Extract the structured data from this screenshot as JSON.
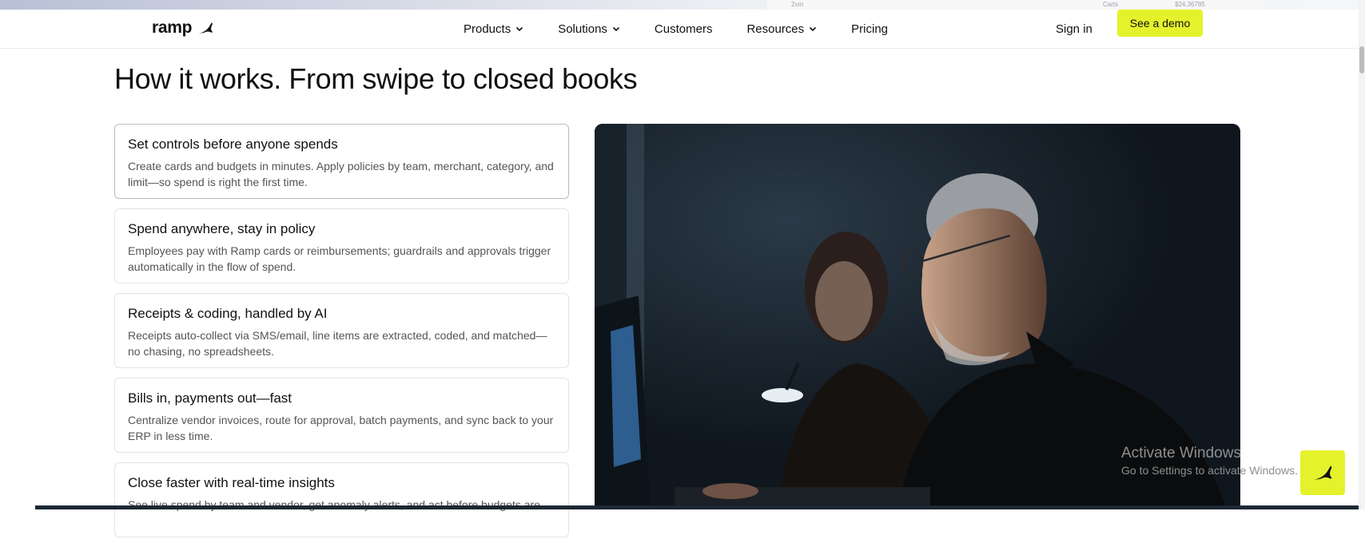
{
  "nav": {
    "logo_text": "ramp",
    "items": [
      {
        "label": "Products",
        "has_dropdown": true
      },
      {
        "label": "Solutions",
        "has_dropdown": true
      },
      {
        "label": "Customers",
        "has_dropdown": false
      },
      {
        "label": "Resources",
        "has_dropdown": true
      },
      {
        "label": "Pricing",
        "has_dropdown": false
      }
    ],
    "sign_in": "Sign in",
    "cta": "See a demo"
  },
  "top_strip": {
    "label_a": "2xm",
    "label_b": "Carts",
    "label_c": "$24,36785"
  },
  "section": {
    "title": "How it works. From swipe to closed books",
    "cards": [
      {
        "title": "Set controls before anyone spends",
        "desc": "Create cards and budgets in minutes. Apply policies by team, merchant, category, and limit—so spend is right the first time.",
        "active": true
      },
      {
        "title": "Spend anywhere, stay in policy",
        "desc": "Employees pay with Ramp cards or reimbursements; guardrails and approvals trigger automatically in the flow of spend.",
        "active": false
      },
      {
        "title": "Receipts & coding, handled by AI",
        "desc": "Receipts auto-collect via SMS/email, line items are extracted, coded, and matched—no chasing, no spreadsheets.",
        "active": false
      },
      {
        "title": "Bills in, payments out—fast",
        "desc": "Centralize vendor invoices, route for approval, batch payments, and sync back to your ERP in less time.",
        "active": false
      },
      {
        "title": "Close faster with real-time insights",
        "desc": "See live spend by team and vendor, get anomaly alerts, and act before budgets are",
        "active": false
      }
    ]
  },
  "watermark": {
    "line1": "Activate Windows",
    "line2": "Go to Settings to activate Windows."
  },
  "colors": {
    "accent": "#e4f22c",
    "text": "#111111",
    "muted": "#555555"
  }
}
